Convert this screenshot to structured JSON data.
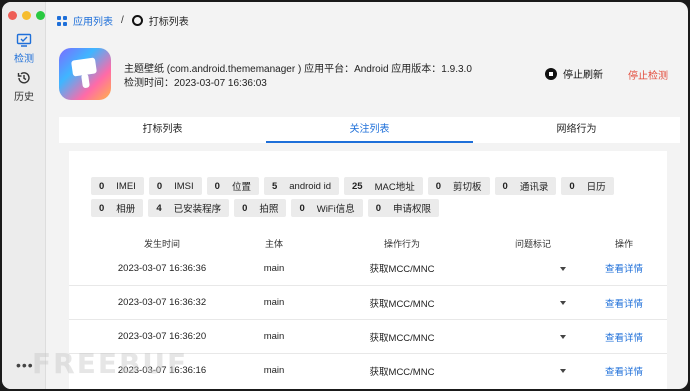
{
  "sidebar": {
    "detect_label": "检测",
    "history_label": "历史"
  },
  "breadcrumb": {
    "parent": "应用列表",
    "separator": "/",
    "current": "打标列表"
  },
  "app": {
    "info_line": "主题壁纸 (com.android.thememanager ) 应用平台：Android 应用版本：1.9.3.0",
    "detect_time": "检测时间：2023-03-07 16:36:03",
    "stop_refresh_label": "停止刷新",
    "stop_detect_label": "停止检测"
  },
  "tabs": [
    {
      "label": "打标列表"
    },
    {
      "label": "关注列表"
    },
    {
      "label": "网络行为"
    }
  ],
  "active_tab": "关注列表",
  "chips": [
    {
      "count": "0",
      "label": "IMEI"
    },
    {
      "count": "0",
      "label": "IMSI"
    },
    {
      "count": "0",
      "label": "位置"
    },
    {
      "count": "5",
      "label": "android id"
    },
    {
      "count": "25",
      "label": "MAC地址"
    },
    {
      "count": "0",
      "label": "剪切板"
    },
    {
      "count": "0",
      "label": "通讯录"
    },
    {
      "count": "0",
      "label": "日历"
    },
    {
      "count": "0",
      "label": "相册"
    },
    {
      "count": "4",
      "label": "已安装程序"
    },
    {
      "count": "0",
      "label": "拍照"
    },
    {
      "count": "0",
      "label": "WiFi信息"
    },
    {
      "count": "0",
      "label": "申请权限"
    }
  ],
  "table": {
    "headers": [
      "发生时间",
      "主体",
      "操作行为",
      "问题标记",
      "操作"
    ],
    "rows": [
      {
        "time": "2023-03-07 16:36:36",
        "subject": "main",
        "action": "获取MCC/MNC",
        "op": "查看详情"
      },
      {
        "time": "2023-03-07 16:36:32",
        "subject": "main",
        "action": "获取MCC/MNC",
        "op": "查看详情"
      },
      {
        "time": "2023-03-07 16:36:20",
        "subject": "main",
        "action": "获取MCC/MNC",
        "op": "查看详情"
      },
      {
        "time": "2023-03-07 16:36:16",
        "subject": "main",
        "action": "获取MCC/MNC",
        "op": "查看详情"
      }
    ]
  },
  "watermark": "FREEBUF",
  "colors": {
    "accent": "#1e6fd9",
    "danger": "#e34b3b"
  }
}
